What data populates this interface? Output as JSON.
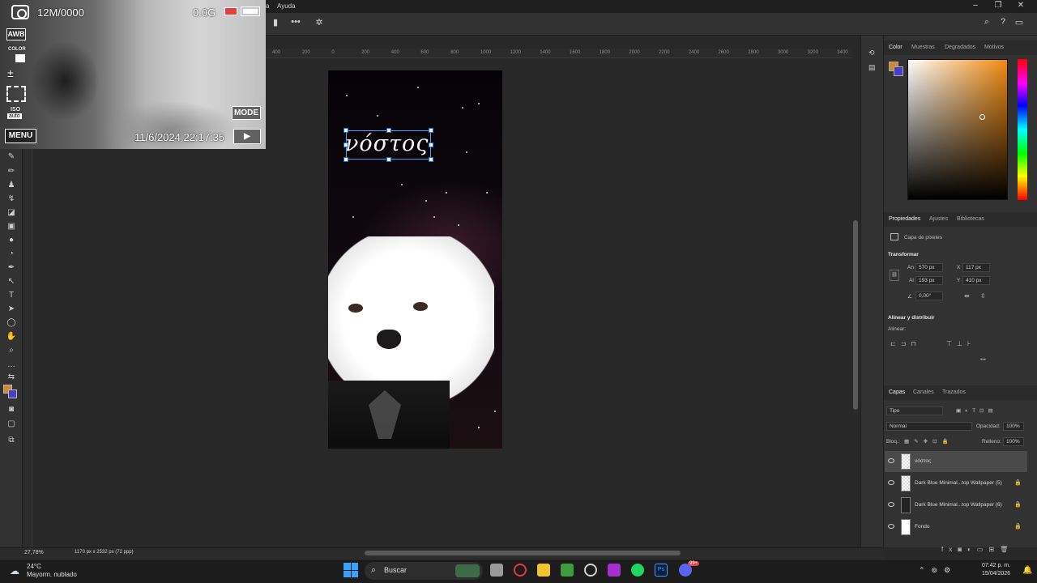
{
  "menubar": {
    "partial_item": "a",
    "help_label": "Ayuda",
    "window_controls": [
      "–",
      "❐",
      "✕"
    ]
  },
  "optionsbar": {
    "more_label": "•••",
    "settings_icon": "gear-icon",
    "search_icon": "search-icon",
    "help_icon": "help-icon",
    "workspace_icon": "workspace-icon"
  },
  "ruler_ticks": [
    "400",
    "200",
    "0",
    "200",
    "400",
    "600",
    "800",
    "1000",
    "1200",
    "1400",
    "1600",
    "1800",
    "2000",
    "2200",
    "2400",
    "2600",
    "2800",
    "3000",
    "3200",
    "3400"
  ],
  "document": {
    "text": "νόστος"
  },
  "camera": {
    "resolution": "12M/0000",
    "storage": "0.0G",
    "awb": "AWB",
    "color_label": "COLOR",
    "iso_label": "ISO",
    "iso_value": "auto",
    "mode_label": "MODE",
    "menu_label": "MENU",
    "datetime": "11/6/2024 22:17:35",
    "play_icon": "play-icon"
  },
  "color_panel": {
    "tabs": [
      "Color",
      "Muestras",
      "Degradados",
      "Motivos"
    ],
    "active_tab": "Color",
    "foreground": "#d08a2c",
    "background": "#4a3fc2"
  },
  "properties_panel": {
    "tabs": [
      "Propiedades",
      "Ajustes",
      "Bibliotecas"
    ],
    "layer_type": "Capa de píxeles",
    "transform_heading": "Transformar",
    "width_label": "An",
    "width_value": "570 px",
    "height_label": "Al",
    "height_value": "193 px",
    "x_label": "X",
    "x_value": "117 px",
    "y_label": "Y",
    "y_value": "410 px",
    "angle_value": "0,00°",
    "align_heading": "Alinear y distribuir",
    "align_label": "Alinear:",
    "more": "•••"
  },
  "layers_panel": {
    "tabs": [
      "Capas",
      "Canales",
      "Trazados"
    ],
    "filter_placeholder": "Tipo",
    "blend_mode": "Normal",
    "opacity_label": "Opacidad:",
    "opacity_value": "100%",
    "lock_label": "Bloq.:",
    "fill_label": "Relleno:",
    "fill_value": "100%",
    "layers": [
      {
        "name": "νόστος",
        "selected": true,
        "locked": false
      },
      {
        "name": "Dark Blue Minimal...top Wallpaper (5)",
        "selected": false,
        "locked": true
      },
      {
        "name": "Dark Blue Minimal...top Wallpaper (6)",
        "selected": false,
        "locked": true
      },
      {
        "name": "Fondo",
        "selected": false,
        "locked": true
      }
    ]
  },
  "statusbar": {
    "zoom": "27,78%",
    "doc_info": "1170 px x 2532 px (72 ppp)"
  },
  "taskbar": {
    "weather_temp": "24°C",
    "weather_desc": "Mayorm. nublado",
    "search_label": "Buscar",
    "time": "07:42 p. m.",
    "date": "15/04/2026",
    "notification_badge": "99+"
  }
}
